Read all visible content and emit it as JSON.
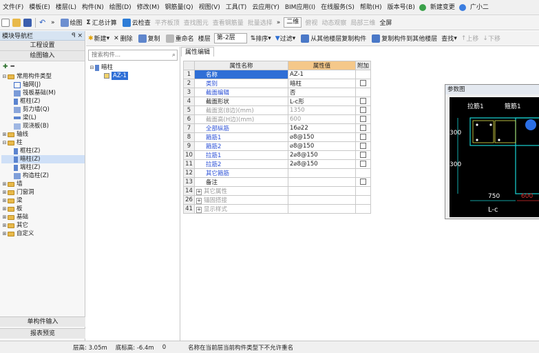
{
  "menu": [
    "文件(F)",
    "模板(E)",
    "楼层(L)",
    "构件(N)",
    "绘图(D)",
    "修改(M)",
    "钢筋量(Q)",
    "视图(V)",
    "工具(T)",
    "云应用(Y)",
    "BIM应用(I)",
    "在线服务(S)",
    "帮助(H)",
    "版本号(B)",
    "新建变更",
    "广小二"
  ],
  "toolbar1": {
    "draw": "绘图",
    "sum": "汇总计算",
    "cloud_check": "云检查",
    "level_slab": "平齐板顶",
    "find_elem": "查找图元",
    "view_rebar": "查看钢筋量",
    "batch_select": "批量选择",
    "view_mode": "二维",
    "top_view": "俯视",
    "dynamic": "动态观察",
    "local3d": "局部三维",
    "fullscreen": "全屏"
  },
  "toolbar2": {
    "new": "新建",
    "delete": "删除",
    "copy": "复制",
    "rename": "重命名",
    "floor_label": "楼层",
    "floor_value": "第-2层",
    "sort": "排序",
    "filter": "过滤",
    "copy_from": "从其他楼层复制构件",
    "copy_to": "复制构件到其他楼层",
    "find": "查找",
    "up": "上移",
    "down": "下移"
  },
  "nav": {
    "title": "模块导航栏",
    "pin": "ꟼ ×",
    "project_settings": "工程设置",
    "drawing_input": "绘图输入",
    "tree": [
      {
        "label": "常用构件类型",
        "level": 0,
        "type": "folder",
        "expand": "-"
      },
      {
        "label": "轴网(J)",
        "level": 1,
        "type": "item"
      },
      {
        "label": "筏板基础(M)",
        "level": 1,
        "type": "item"
      },
      {
        "label": "框柱(Z)",
        "level": 1,
        "type": "item"
      },
      {
        "label": "剪力墙(Q)",
        "level": 1,
        "type": "item"
      },
      {
        "label": "梁(L)",
        "level": 1,
        "type": "item"
      },
      {
        "label": "现浇板(B)",
        "level": 1,
        "type": "item"
      },
      {
        "label": "轴线",
        "level": 0,
        "type": "folder",
        "expand": "+"
      },
      {
        "label": "柱",
        "level": 0,
        "type": "folder",
        "expand": "-"
      },
      {
        "label": "框柱(Z)",
        "level": 1,
        "type": "item"
      },
      {
        "label": "暗柱(Z)",
        "level": 1,
        "type": "item",
        "selected": true
      },
      {
        "label": "端柱(Z)",
        "level": 1,
        "type": "item"
      },
      {
        "label": "构造柱(Z)",
        "level": 1,
        "type": "item"
      },
      {
        "label": "墙",
        "level": 0,
        "type": "folder",
        "expand": "+"
      },
      {
        "label": "门窗洞",
        "level": 0,
        "type": "folder",
        "expand": "+"
      },
      {
        "label": "梁",
        "level": 0,
        "type": "folder",
        "expand": "+"
      },
      {
        "label": "板",
        "level": 0,
        "type": "folder",
        "expand": "+"
      },
      {
        "label": "基础",
        "level": 0,
        "type": "folder",
        "expand": "+"
      },
      {
        "label": "其它",
        "level": 0,
        "type": "folder",
        "expand": "+"
      },
      {
        "label": "自定义",
        "level": 0,
        "type": "folder",
        "expand": "+"
      }
    ],
    "single_input": "单构件输入",
    "report_preview": "报表预览"
  },
  "component_list": {
    "search_placeholder": "搜索构件...",
    "root": "暗柱",
    "child": "AZ-1"
  },
  "property_grid": {
    "tab": "属性编辑",
    "headers": {
      "name": "属性名称",
      "value": "属性值",
      "add": "附加"
    },
    "rows": [
      {
        "num": "1",
        "name": "名称",
        "value": "AZ-1",
        "style": "selected",
        "cb": false
      },
      {
        "num": "2",
        "name": "类别",
        "value": "暗柱",
        "style": "link",
        "cb": true
      },
      {
        "num": "3",
        "name": "截面编辑",
        "value": "否",
        "style": "link",
        "cb": false
      },
      {
        "num": "4",
        "name": "截面形状",
        "value": "L-c形",
        "style": "normal",
        "cb": true
      },
      {
        "num": "5",
        "name": "截面宽(B边)(mm)",
        "value": "1350",
        "style": "gray",
        "cb": true
      },
      {
        "num": "6",
        "name": "截面高(H边)(mm)",
        "value": "600",
        "style": "gray",
        "cb": true
      },
      {
        "num": "7",
        "name": "全部纵筋",
        "value": "16⌀22",
        "style": "link",
        "cb": true
      },
      {
        "num": "8",
        "name": "箍筋1",
        "value": "⌀8@150",
        "style": "link",
        "cb": true
      },
      {
        "num": "9",
        "name": "箍筋2",
        "value": "⌀8@150",
        "style": "link",
        "cb": true
      },
      {
        "num": "10",
        "name": "拉筋1",
        "value": "2⌀8@150",
        "style": "link",
        "cb": true
      },
      {
        "num": "11",
        "name": "拉筋2",
        "value": "2⌀8@150",
        "style": "link",
        "cb": true
      },
      {
        "num": "12",
        "name": "其它箍筋",
        "value": "",
        "style": "link",
        "cb": false
      },
      {
        "num": "13",
        "name": "备注",
        "value": "",
        "style": "normal",
        "cb": true
      },
      {
        "num": "14",
        "name": "其它属性",
        "value": "",
        "style": "group",
        "cb": false
      },
      {
        "num": "26",
        "name": "锚固搭接",
        "value": "",
        "style": "group",
        "cb": false
      },
      {
        "num": "41",
        "name": "显示样式",
        "value": "",
        "style": "group",
        "cb": false
      }
    ]
  },
  "param_window": {
    "title": "参数图",
    "labels": {
      "tie1": "拉筋1",
      "stirrup1": "箍筋1",
      "dim300a": "300",
      "dim300b": "300",
      "dim750": "750",
      "shape": "L-c",
      "red_dim": "600"
    }
  },
  "status": {
    "floor_height": "层高: 3.05m",
    "bottom_elev": "底标高: -6.4m",
    "zero": "0",
    "message": "名称在当前层当前构件类型下不允许重名"
  },
  "colors": {
    "accent": "#2f6fd6",
    "value_header": "#f5c88a",
    "link": "#2a4fd6",
    "cad_bg": "#000000",
    "cad_line": "#19d6d6"
  }
}
